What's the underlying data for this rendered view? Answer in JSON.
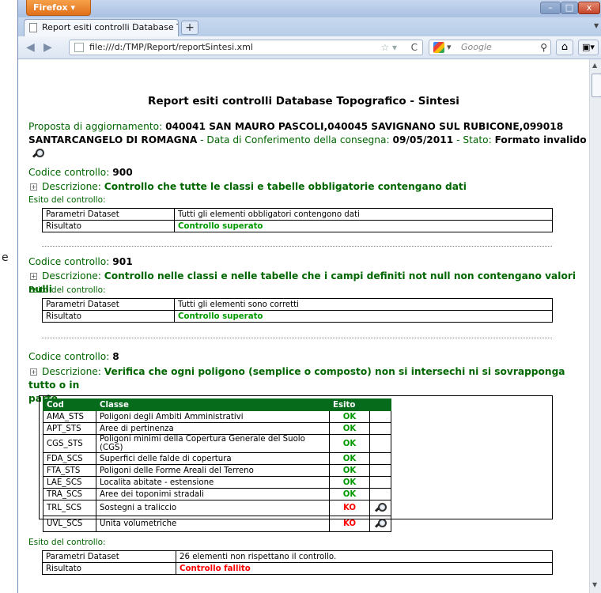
{
  "outer": {
    "left_char": "e"
  },
  "browser": {
    "menu_button": "Firefox",
    "window_controls": [
      "–",
      "□",
      "x"
    ],
    "tab_title": "Report esiti controlli Database Topografi...",
    "new_tab": "+",
    "url": "file:///d:/TMP/Report/reportSintesi.xml",
    "search_placeholder": "Google"
  },
  "report": {
    "title": "Report esiti controlli Database Topografico - Sintesi",
    "proposal_label": "Proposta di aggiornamento:",
    "proposal_value_line1": "040041 SAN MAURO PASCOLI,040045 SAVIGNANO SUL RUBICONE,099018",
    "proposal_value_line2": "SANTARCANGELO DI ROMAGNA",
    "delivery_label": "- Data di Conferimento della consegna:",
    "delivery_date": "09/05/2011",
    "state_label": "- Stato:",
    "state_value": "Formato invalido",
    "checks": [
      {
        "code_label": "Codice controllo:",
        "code": "900",
        "desc_label": "Descrizione:",
        "desc": "Controllo che tutte le classi e tabelle obbligatorie contengano dati",
        "esito_label": "Esito del controllo:",
        "param_label": "Parametri Dataset",
        "param_value": "Tutti gli elementi obbligatori contengono dati",
        "result_label": "Risultato",
        "result_value": "Controllo superato"
      },
      {
        "code_label": "Codice controllo:",
        "code": "901",
        "desc_label": "Descrizione:",
        "desc": "Controllo nelle classi e nelle tabelle che i campi definiti not null non contengano valori nulli",
        "esito_label": "Esito del controllo:",
        "param_label": "Parametri Dataset",
        "param_value": "Tutti gli elementi sono corretti",
        "result_label": "Risultato",
        "result_value": "Controllo superato"
      },
      {
        "code_label": "Codice controllo:",
        "code": "8",
        "desc_label": "Descrizione:",
        "desc_line1": "Verifica che ogni poligono (semplice o composto) non si intersechi ni si sovrapponga tutto o in",
        "desc_line2": "parte",
        "esito_label": "Esito del controllo:",
        "param_label": "Parametri Dataset",
        "param_value": "26 elementi non rispettano il controllo.",
        "result_label": "Risultato",
        "result_value": "Controllo fallito"
      }
    ],
    "class_table": {
      "headers": [
        "Cod",
        "Classe",
        "Esito"
      ],
      "rows": [
        {
          "cod": "AMA_STS",
          "classe": "Poligoni degli Ambiti Amministrativi",
          "esito": "OK"
        },
        {
          "cod": "APT_STS",
          "classe": "Aree di pertinenza",
          "esito": "OK"
        },
        {
          "cod": "CGS_STS",
          "classe": "Poligoni minimi della Copertura Generale del Suolo (CGS)",
          "esito": "OK"
        },
        {
          "cod": "FDA_SCS",
          "classe": "Superfici delle falde di copertura",
          "esito": "OK"
        },
        {
          "cod": "FTA_STS",
          "classe": "Poligoni delle Forme Areali del Terreno",
          "esito": "OK"
        },
        {
          "cod": "LAE_SCS",
          "classe": "Localita abitate - estensione",
          "esito": "OK"
        },
        {
          "cod": "TRA_SCS",
          "classe": "Aree dei toponimi stradali",
          "esito": "OK"
        },
        {
          "cod": "TRL_SCS",
          "classe": "Sostegni a traliccio",
          "esito": "KO"
        },
        {
          "cod": "UVL_SCS",
          "classe": "Unita volumetriche",
          "esito": "KO"
        }
      ]
    }
  },
  "colors": {
    "ok": "#009900",
    "ko": "#ff0000",
    "label_green": "#006600",
    "header_green": "#066b1a"
  }
}
